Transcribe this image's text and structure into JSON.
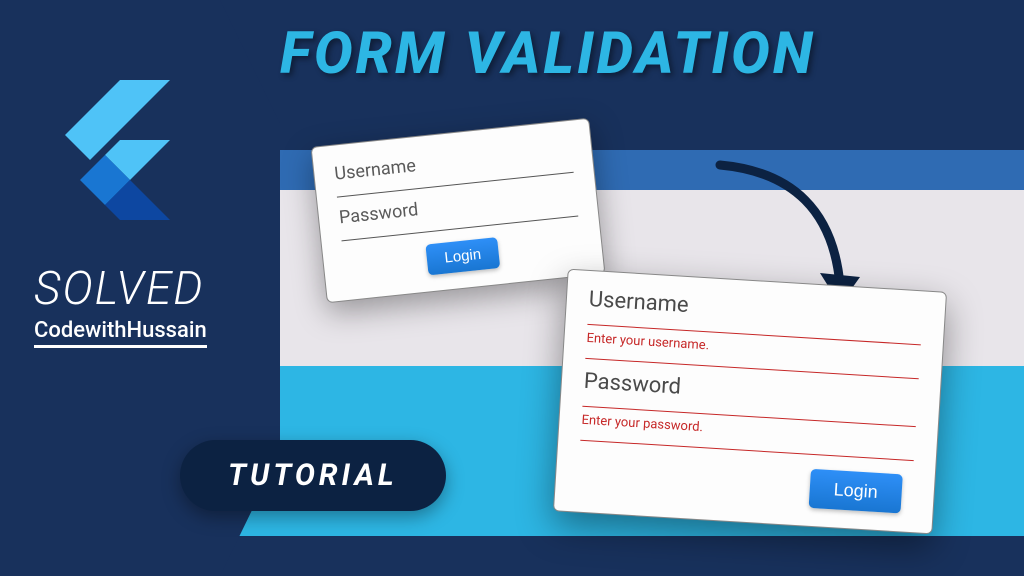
{
  "title": "FORM VALIDATION",
  "solved_label": "SOLVED",
  "brand": "CodewithHussain",
  "tutorial_label": "TUTORIAL",
  "form_a": {
    "username_label": "Username",
    "password_label": "Password",
    "login_button": "Login"
  },
  "form_b": {
    "username_label": "Username",
    "username_error": "Enter your username.",
    "password_label": "Password",
    "password_error": "Enter your password.",
    "login_button": "Login"
  }
}
